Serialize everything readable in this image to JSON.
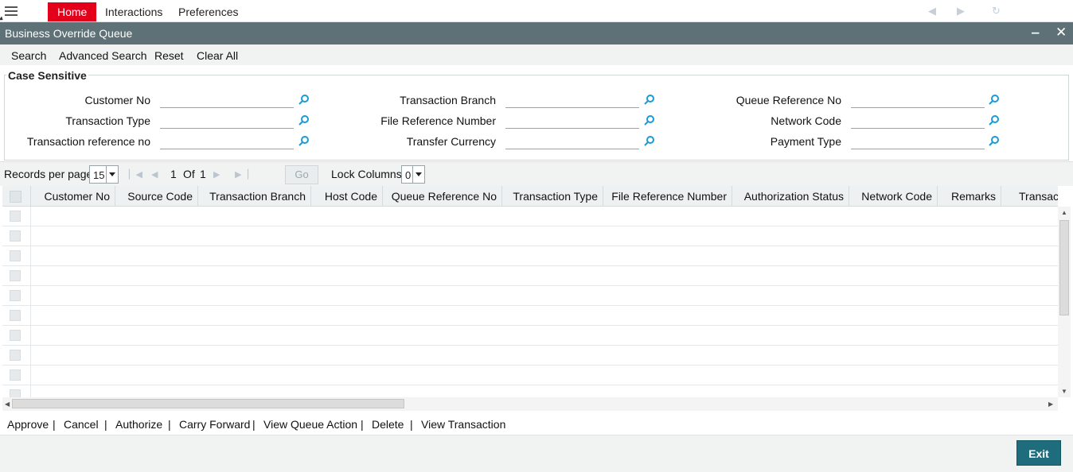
{
  "menu": {
    "tabs": [
      "Home",
      "Interactions",
      "Preferences"
    ],
    "active_tab": "Home"
  },
  "window": {
    "title": "Business Override Queue",
    "minimize_glyph": "‒",
    "close_glyph": "✕"
  },
  "toolbar": {
    "search": "Search",
    "advanced_search": "Advanced Search",
    "reset": "Reset",
    "clear_all": "Clear All"
  },
  "criteria": {
    "legend": "Case Sensitive",
    "fields": [
      {
        "label": "Customer No",
        "value": ""
      },
      {
        "label": "Transaction Type",
        "value": ""
      },
      {
        "label": "Transaction reference no",
        "value": ""
      },
      {
        "label": "Transaction Branch",
        "value": ""
      },
      {
        "label": "File Reference Number",
        "value": ""
      },
      {
        "label": "Transfer Currency",
        "value": ""
      },
      {
        "label": "Queue Reference No",
        "value": ""
      },
      {
        "label": "Network Code",
        "value": ""
      },
      {
        "label": "Payment Type",
        "value": ""
      }
    ]
  },
  "pager": {
    "records_per_page_label": "Records per page",
    "records_per_page": "15",
    "current_page": "1",
    "of_label": "Of",
    "total_pages": "1",
    "go_label": "Go",
    "lock_columns_label": "Lock Columns",
    "lock_columns": "0"
  },
  "grid": {
    "columns": [
      "Customer No",
      "Source Code",
      "Transaction Branch",
      "Host Code",
      "Queue Reference No",
      "Transaction Type",
      "File Reference Number",
      "Authorization Status",
      "Network Code",
      "Remarks",
      "Transact"
    ],
    "rows": 10
  },
  "actions": [
    "Approve",
    "Cancel",
    "Authorize",
    "Carry Forward",
    "View Queue Action",
    "Delete",
    "View Transaction"
  ],
  "footer": {
    "exit": "Exit"
  },
  "colors": {
    "accent_red": "#e3001b",
    "title_bar": "#5d7176",
    "exit_button": "#1f6d7c"
  }
}
